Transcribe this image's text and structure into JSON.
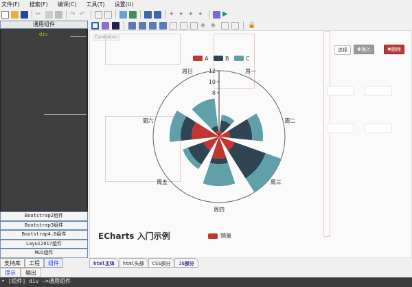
{
  "menu": [
    "文件(F)",
    "搜索(F)",
    "编译(C)",
    "工具(T)",
    "设置(U)"
  ],
  "left": {
    "header": "通用组件",
    "selected": "div",
    "groups": [
      "Bootstrap2组件",
      "Bootstrap3组件",
      "Bootstrap4.0组件",
      "Layui2017组件",
      "MUI组件"
    ],
    "tabs": [
      "支持库",
      "工程",
      "组件"
    ]
  },
  "editor": {
    "container_label": "Container",
    "tabs": [
      "html主体",
      "html头部",
      "CSS部分",
      "JS部分"
    ],
    "right_buttons": {
      "select": "选择",
      "insert": "插入",
      "delete": "删除"
    }
  },
  "output": {
    "tabs": [
      "提示",
      "输出"
    ],
    "console": "• [组件] div —>通用组件"
  },
  "chart_data": {
    "type": "bar",
    "coordinate": "polar",
    "stacked": true,
    "categories": [
      "周一",
      "周二",
      "周三",
      "周四",
      "周五",
      "周六",
      "周日"
    ],
    "radius_ticks": [
      8,
      10,
      12
    ],
    "rlim": [
      0,
      12
    ],
    "series": [
      {
        "name": "A",
        "color": "#c23531",
        "values": [
          1,
          2,
          3,
          4,
          3,
          5,
          1
        ]
      },
      {
        "name": "B",
        "color": "#2f4554",
        "values": [
          2,
          4,
          6,
          1,
          3,
          2,
          1
        ]
      },
      {
        "name": "C",
        "color": "#61a0a8",
        "values": [
          1,
          2,
          3,
          4,
          1,
          2,
          5
        ]
      }
    ],
    "legend": "top"
  },
  "second_chart": {
    "title": "ECharts 入门示例",
    "legend": "销量",
    "color": "#c23531"
  }
}
